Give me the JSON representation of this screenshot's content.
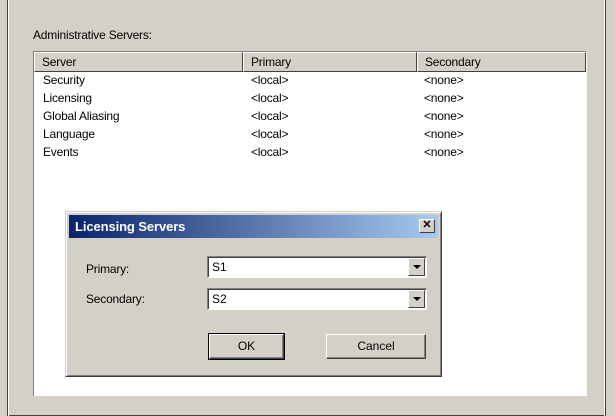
{
  "section_label": "Administrative Servers:",
  "list": {
    "columns": [
      "Server",
      "Primary",
      "Secondary"
    ],
    "rows": [
      [
        "Security",
        "<local>",
        "<none>"
      ],
      [
        "Licensing",
        "<local>",
        "<none>"
      ],
      [
        "Global Aliasing",
        "<local>",
        "<none>"
      ],
      [
        "Language",
        "<local>",
        "<none>"
      ],
      [
        "Events",
        "<local>",
        "<none>"
      ]
    ]
  },
  "dialog": {
    "title": "Licensing Servers",
    "close_glyph": "✕",
    "primary_label": "Primary:",
    "primary_value": "S1",
    "secondary_label": "Secondary:",
    "secondary_value": "S2",
    "ok_label": "OK",
    "cancel_label": "Cancel"
  }
}
